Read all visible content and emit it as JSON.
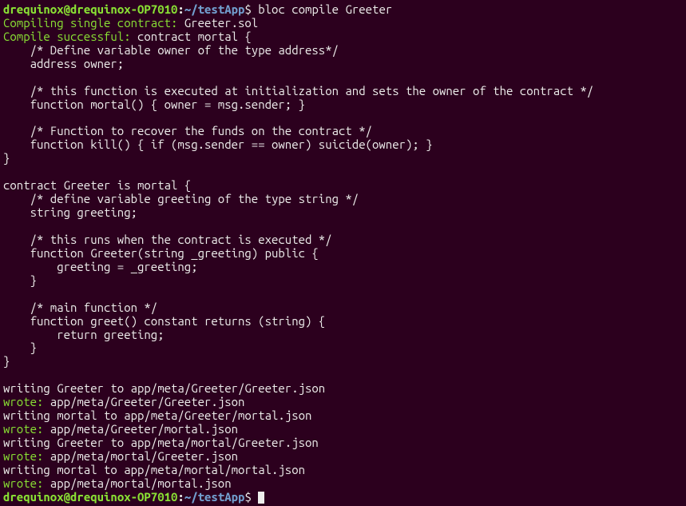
{
  "prompt": {
    "user": "drequinox",
    "host": "drequinox-OP7010",
    "path": "~/testApp",
    "symbol": "$"
  },
  "command": " bloc compile Greeter",
  "output": {
    "line1_prefix": "Compiling single contract:",
    "line1_suffix": " Greeter.sol",
    "line2_prefix": "Compile successful:",
    "code_block": " contract mortal {\n    /* Define variable owner of the type address*/\n    address owner;\n\n    /* this function is executed at initialization and sets the owner of the contract */\n    function mortal() { owner = msg.sender; }\n\n    /* Function to recover the funds on the contract */\n    function kill() { if (msg.sender == owner) suicide(owner); }\n}\n\ncontract Greeter is mortal {\n    /* define variable greeting of the type string */\n    string greeting;\n\n    /* this runs when the contract is executed */\n    function Greeter(string _greeting) public {\n        greeting = _greeting;\n    }\n\n    /* main function */\n    function greet() constant returns (string) {\n        return greeting;\n    }\n}\n",
    "writing1": "writing Greeter to app/meta/Greeter/Greeter.json",
    "wrote_label": "wrote:",
    "wrote1": " app/meta/Greeter/Greeter.json",
    "writing2": "writing mortal to app/meta/Greeter/mortal.json",
    "wrote2": " app/meta/Greeter/mortal.json",
    "writing3": "writing Greeter to app/meta/mortal/Greeter.json",
    "wrote3": " app/meta/mortal/Greeter.json",
    "writing4": "writing mortal to app/meta/mortal/mortal.json",
    "wrote4": " app/meta/mortal/mortal.json"
  }
}
